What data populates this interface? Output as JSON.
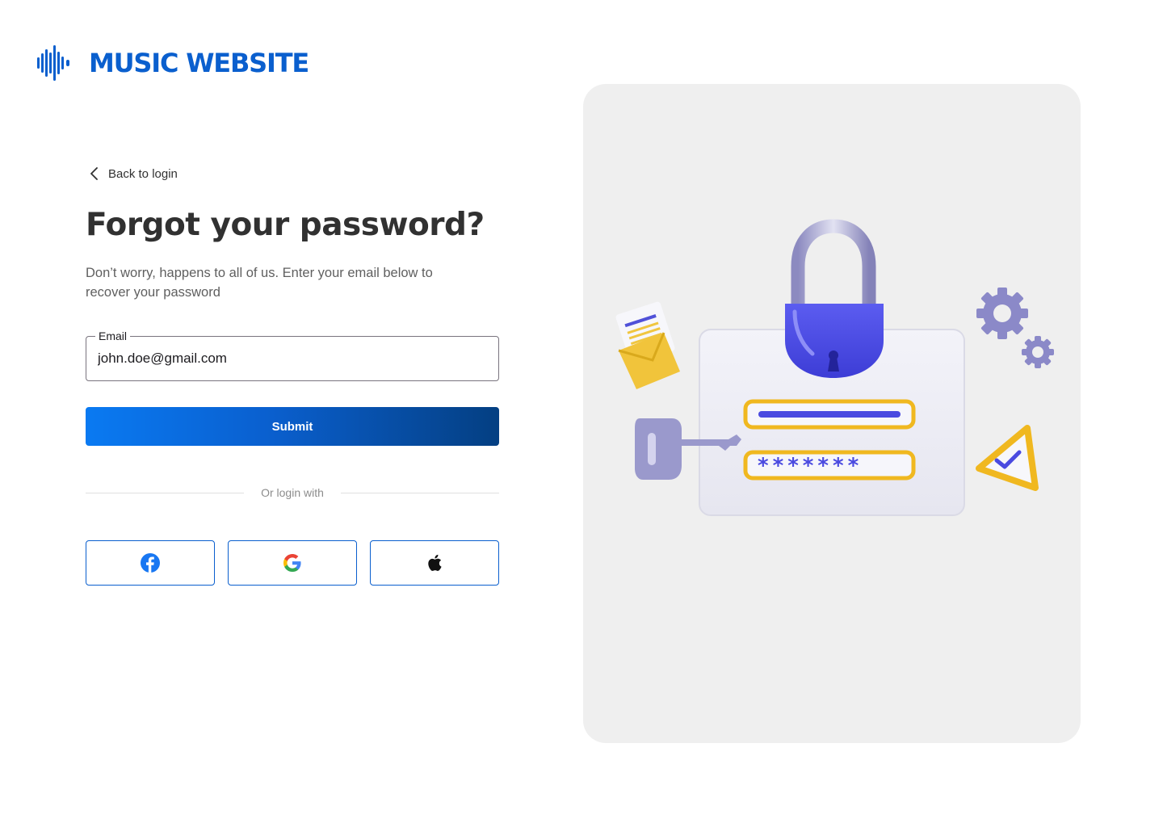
{
  "brand": {
    "name": "MUSIC WEBSITE",
    "color": "#0a5fce",
    "icon": "sound-wave-icon"
  },
  "nav": {
    "back_label": "Back to login",
    "back_icon": "chevron-left-icon"
  },
  "page": {
    "title": "Forgot your password?",
    "subtitle": "Don’t worry, happens to all of us. Enter your email below to recover your password"
  },
  "form": {
    "email_label": "Email",
    "email_value": "john.doe@gmail.com",
    "submit_label": "Submit"
  },
  "social": {
    "divider_text": "Or login with",
    "providers": [
      {
        "name": "Facebook",
        "icon": "facebook-icon",
        "color": "#1877f2"
      },
      {
        "name": "Google",
        "icon": "google-icon",
        "color": "#4285f4"
      },
      {
        "name": "Apple",
        "icon": "apple-icon",
        "color": "#000000"
      }
    ],
    "border_color": "#0a5fce"
  },
  "illustration": {
    "subject": "password-security-illustration",
    "masked_password": "*******"
  }
}
